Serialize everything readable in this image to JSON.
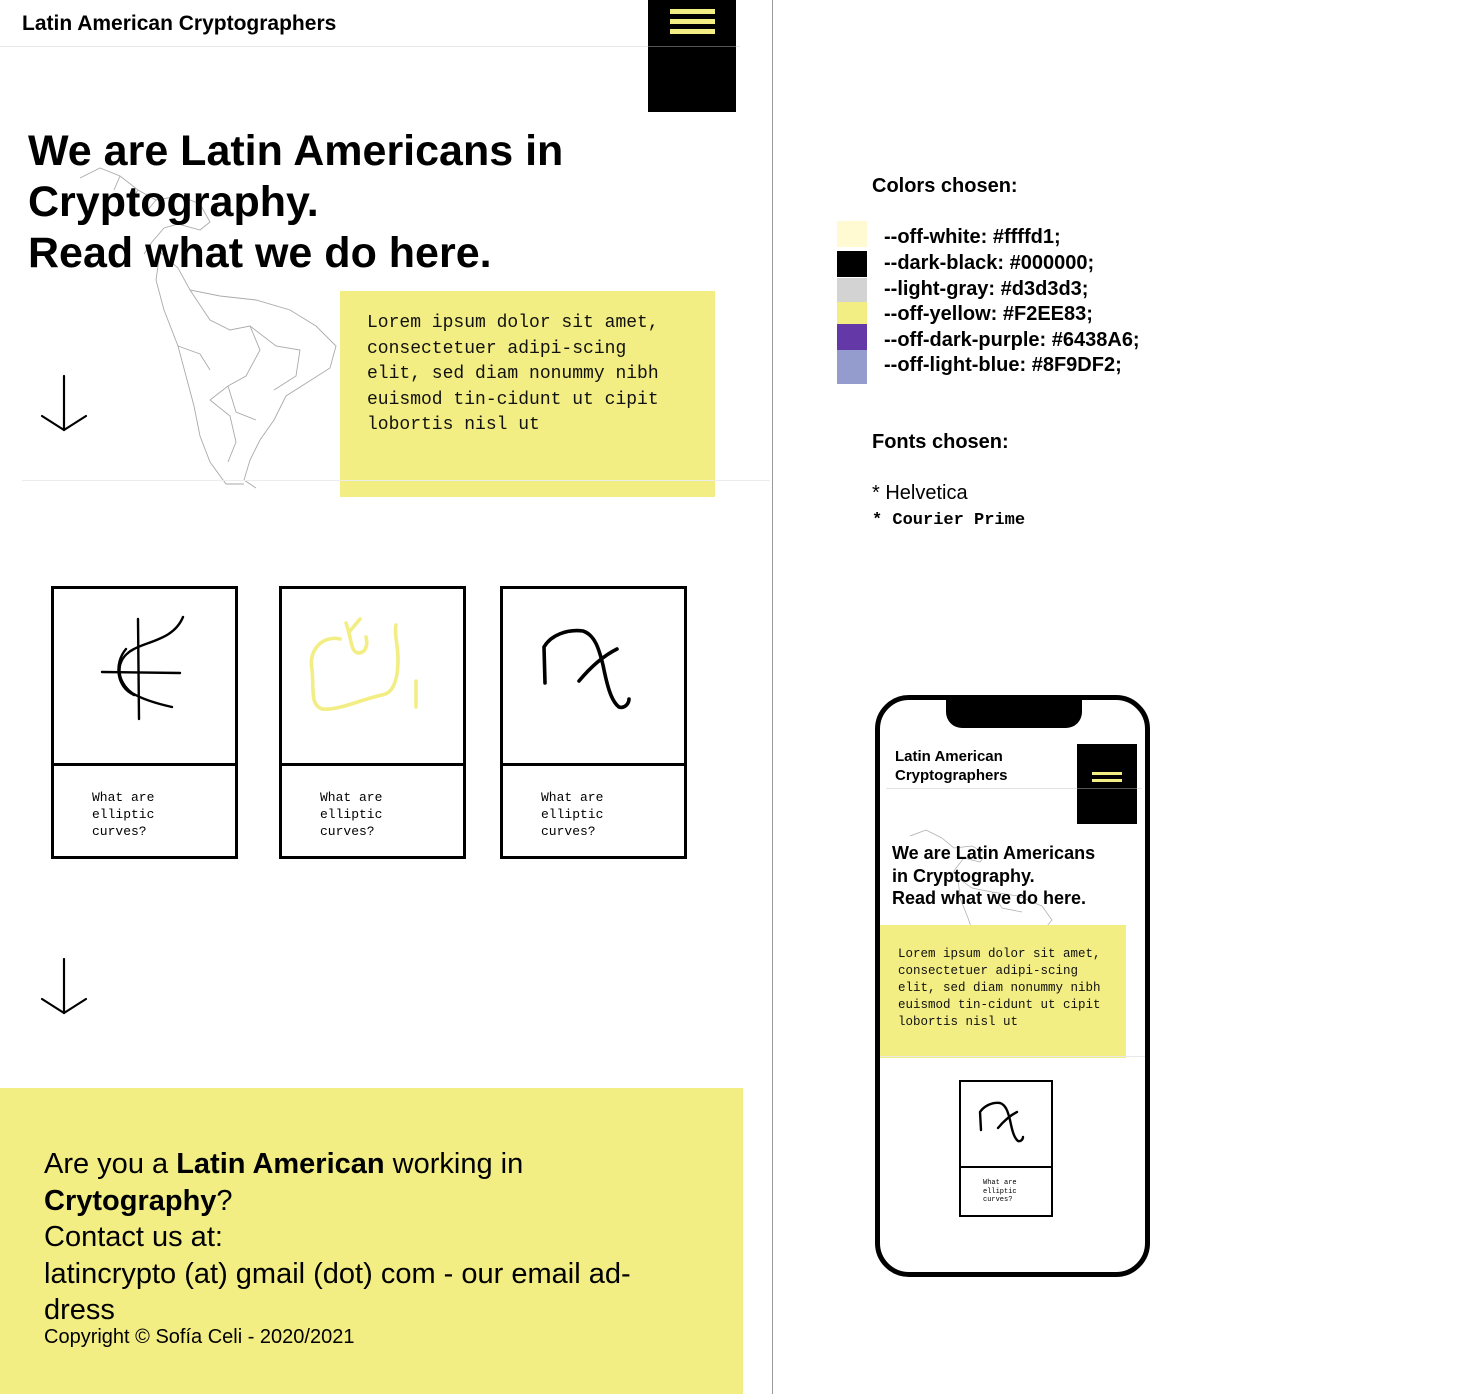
{
  "desktop": {
    "site_title": "Latin American Cryptographers",
    "hero_line1": "We are Latin Americans in",
    "hero_line2": "Cryptography.",
    "hero_line3": "Read what we do here.",
    "lorem": "Lorem ipsum dolor sit amet, consectetuer adipi-scing elit, sed diam nonummy nibh euismod tin-cidunt ut cipit lobortis nisl ut",
    "cards": [
      {
        "caption": "What are elliptic curves?"
      },
      {
        "caption": "What are elliptic curves?"
      },
      {
        "caption": "What are elliptic curves?"
      }
    ],
    "footer": {
      "cta_pre": "Are you a ",
      "cta_bold1": "Latin American",
      "cta_mid": " working in ",
      "cta_bold2": "Crytography",
      "cta_post": "?",
      "contact": "Contact us at:",
      "email": "latincrypto (at) gmail (dot) com - our email ad-dress",
      "copyright": "Copyright © Sofía Celi - 2020/2021"
    }
  },
  "guide": {
    "colors_heading": "Colors chosen:",
    "colors": [
      {
        "label": "--off-white: #ffffd1;",
        "hex": "#fffad1"
      },
      {
        "label": "--dark-black: #000000;",
        "hex": "#000000"
      },
      {
        "label": "--light-gray: #d3d3d3;",
        "hex": "#d3d3d3"
      },
      {
        "label": "--off-yellow: #F2EE83;",
        "hex": "#F2EE83"
      },
      {
        "label": "--off-dark-purple: #6438A6;",
        "hex": "#6438A6"
      },
      {
        "label": "--off-light-blue: #8F9DF2;",
        "hex": "#949ccd"
      }
    ],
    "fonts_heading": "Fonts chosen:",
    "fonts": [
      "* Helvetica",
      "* Courier Prime"
    ]
  },
  "phone": {
    "site_title": "Latin American Cryptographers",
    "hero_line1": "We are Latin Americans",
    "hero_line2": "in Cryptography.",
    "hero_line3": "Read what we do here.",
    "lorem": "Lorem ipsum dolor sit amet, consectetuer adipi-scing elit, sed diam nonummy nibh euismod tin-cidunt ut cipit lobortis nisl ut",
    "card_caption": "What are elliptic curves?"
  },
  "accent": "#F2EE83",
  "icons": [
    "hamburger-menu-icon",
    "down-arrow-icon",
    "map-illustration",
    "glyph-icon"
  ]
}
